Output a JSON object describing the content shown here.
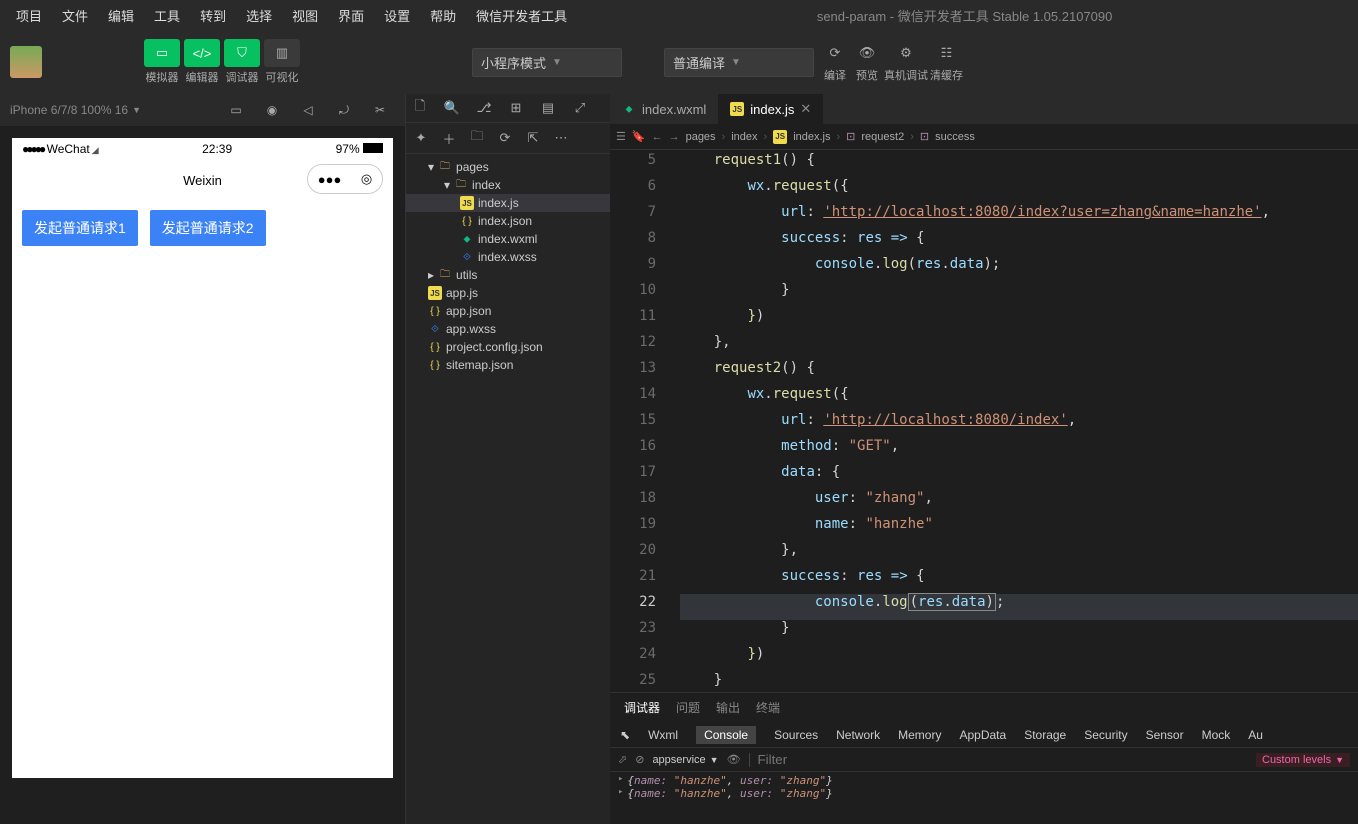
{
  "menubar": [
    "项目",
    "文件",
    "编辑",
    "工具",
    "转到",
    "选择",
    "视图",
    "界面",
    "设置",
    "帮助",
    "微信开发者工具"
  ],
  "window_title": "send-param - 微信开发者工具 Stable 1.05.2107090",
  "toolbar_labels": [
    "模拟器",
    "编辑器",
    "调试器",
    "可视化"
  ],
  "mode_select": "小程序模式",
  "compile_select": "普通编译",
  "action_labels": [
    "编译",
    "预览",
    "真机调试",
    "清缓存"
  ],
  "device_label": "iPhone 6/7/8 100% 16",
  "sim": {
    "wechat": "WeChat",
    "time": "22:39",
    "battery": "97%",
    "title": "Weixin",
    "btn1": "发起普通请求1",
    "btn2": "发起普通请求2"
  },
  "tree": [
    {
      "lvl": 1,
      "name": "pages",
      "type": "folder",
      "open": true
    },
    {
      "lvl": 2,
      "name": "index",
      "type": "folder",
      "open": true
    },
    {
      "lvl": 3,
      "name": "index.js",
      "type": "js",
      "sel": true
    },
    {
      "lvl": 3,
      "name": "index.json",
      "type": "json"
    },
    {
      "lvl": 3,
      "name": "index.wxml",
      "type": "wxml"
    },
    {
      "lvl": 3,
      "name": "index.wxss",
      "type": "wxss"
    },
    {
      "lvl": 1,
      "name": "utils",
      "type": "folder",
      "open": false
    },
    {
      "lvl": 1,
      "name": "app.js",
      "type": "js"
    },
    {
      "lvl": 1,
      "name": "app.json",
      "type": "json"
    },
    {
      "lvl": 1,
      "name": "app.wxss",
      "type": "wxss"
    },
    {
      "lvl": 1,
      "name": "project.config.json",
      "type": "json"
    },
    {
      "lvl": 1,
      "name": "sitemap.json",
      "type": "json"
    }
  ],
  "tabs": [
    {
      "name": "index.wxml",
      "icon": "wxml"
    },
    {
      "name": "index.js",
      "icon": "js",
      "active": true,
      "close": true
    }
  ],
  "breadcrumb": [
    "pages",
    "index",
    "index.js",
    "request2",
    "success"
  ],
  "code_start": 5,
  "code_cursor": 22,
  "code": [
    {
      "html": "    <span class='tok-fn'>request1</span>() <span class='tok-brace'>{</span>"
    },
    {
      "html": "        <span class='tok-var'>wx</span>.<span class='tok-fn'>request</span>(<span class='tok-brace'>{</span>"
    },
    {
      "html": "            <span class='tok-key'>url</span>: <span class='tok-url'>'http://localhost:8080/index?user=zhang&amp;name=hanzhe'</span>,"
    },
    {
      "html": "            <span class='tok-key'>success</span>: <span class='tok-var'>res</span> <span class='tok-key'>=></span> <span class='tok-brace'>{</span>"
    },
    {
      "html": "                <span class='tok-var'>console</span>.<span class='tok-fn'>log</span>(<span class='tok-var'>res</span>.<span class='tok-var'>data</span>);"
    },
    {
      "html": "            <span class='tok-brace'>}</span>"
    },
    {
      "html": "        <span class='tok-punc'>}</span>)"
    },
    {
      "html": "    <span class='tok-brace'>}</span>,"
    },
    {
      "html": "    <span class='tok-fn'>request2</span>() <span class='tok-brace'>{</span>"
    },
    {
      "html": "        <span class='tok-var'>wx</span>.<span class='tok-fn'>request</span>(<span class='tok-brace'>{</span>"
    },
    {
      "html": "            <span class='tok-key'>url</span>: <span class='tok-url'>'http://localhost:8080/index'</span>,"
    },
    {
      "html": "            <span class='tok-key'>method</span>: <span class='tok-str'>\"GET\"</span>,"
    },
    {
      "html": "            <span class='tok-key'>data</span>: <span class='tok-brace'>{</span>"
    },
    {
      "html": "                <span class='tok-key'>user</span>: <span class='tok-str'>\"zhang\"</span>,"
    },
    {
      "html": "                <span class='tok-key'>name</span>: <span class='tok-str'>\"hanzhe\"</span>"
    },
    {
      "html": "            <span class='tok-brace'>}</span>,"
    },
    {
      "html": "            <span class='tok-key'>success</span>: <span class='tok-var'>res</span> <span class='tok-key'>=></span> <span class='tok-brace'>{</span>"
    },
    {
      "html": "                <span class='tok-var'>console</span>.<span class='tok-fn'>log</span><span class='tok-curs'>(<span class='tok-var'>res</span>.<span class='tok-var'>data</span>)</span>;"
    },
    {
      "html": "            <span class='tok-brace'>}</span>"
    },
    {
      "html": "        <span class='tok-punc'>}</span>)"
    },
    {
      "html": "    <span class='tok-brace'>}</span>"
    }
  ],
  "bottom_tabs": [
    "调试器",
    "问题",
    "输出",
    "终端"
  ],
  "devtools": [
    "Wxml",
    "Console",
    "Sources",
    "Network",
    "Memory",
    "AppData",
    "Storage",
    "Security",
    "Sensor",
    "Mock",
    "Au"
  ],
  "ctx": "appservice",
  "filter_ph": "Filter",
  "levels": "Custom levels",
  "console_rows": [
    "{name: \"hanzhe\", user: \"zhang\"}",
    "{name: \"hanzhe\", user: \"zhang\"}"
  ]
}
